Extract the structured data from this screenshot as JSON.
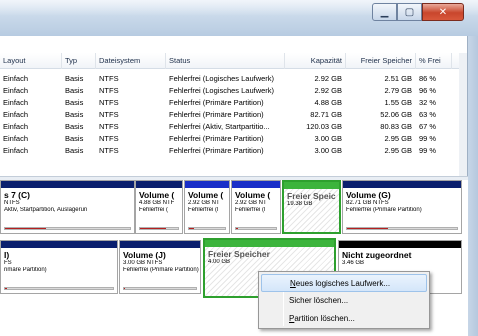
{
  "window": {
    "minimize_icon": "minimize-icon",
    "maximize_icon": "maximize-icon",
    "close_icon": "close-icon",
    "minimize_glyph": "▁",
    "maximize_glyph": "▢",
    "close_glyph": "✕"
  },
  "table": {
    "columns": [
      "Layout",
      "Typ",
      "Dateisystem",
      "Status",
      "Kapazität",
      "Freier Speicher",
      "% Frei"
    ],
    "rows": [
      [
        "Einfach",
        "Basis",
        "NTFS",
        "Fehlerfrei (Logisches Laufwerk)",
        "2.92 GB",
        "2.51 GB",
        "86 %"
      ],
      [
        "Einfach",
        "Basis",
        "NTFS",
        "Fehlerfrei (Logisches Laufwerk)",
        "2.92 GB",
        "2.79 GB",
        "96 %"
      ],
      [
        "Einfach",
        "Basis",
        "NTFS",
        "Fehlerfrei (Primäre Partition)",
        "4.88 GB",
        "1.55 GB",
        "32 %"
      ],
      [
        "Einfach",
        "Basis",
        "NTFS",
        "Fehlerfrei (Primäre Partition)",
        "82.71 GB",
        "52.06 GB",
        "63 %"
      ],
      [
        "Einfach",
        "Basis",
        "NTFS",
        "Fehlerfrei (Aktiv, Startpartitio...",
        "120.03 GB",
        "80.83 GB",
        "67 %"
      ],
      [
        "Einfach",
        "Basis",
        "NTFS",
        "Fehlerfrei (Primäre Partition)",
        "3.00 GB",
        "2.95 GB",
        "99 %"
      ],
      [
        "Einfach",
        "Basis",
        "NTFS",
        "Fehlerfrei (Primäre Partition)",
        "3.00 GB",
        "2.95 GB",
        "99 %"
      ]
    ]
  },
  "disk1": {
    "partitions": [
      {
        "title": "s 7 (C)",
        "line1": "NTFS",
        "line2": "Aktiv, Startpartition, Auslagerun",
        "used_fraction": 0.33,
        "bar": "#0a1f6e"
      },
      {
        "title": "Volume (",
        "line1": "4.88 GB NTF",
        "line2": "Fehlerfrei (",
        "used_fraction": 0.68,
        "bar": "#0a1f6e"
      },
      {
        "title": "Volume (",
        "line1": "2.92 GB NT",
        "line2": "Fehlerfrei (l",
        "used_fraction": 0.14,
        "bar": "#1a2fc8"
      },
      {
        "title": "Volume (",
        "line1": "2.92 GB NT",
        "line2": "Fehlerfrei (l",
        "used_fraction": 0.04,
        "bar": "#1a2fc8"
      },
      {
        "title": "Freier Speic",
        "line1": "19.38 GB",
        "line2": "",
        "used_fraction": 0,
        "bar": "#3cb43c"
      },
      {
        "title": "Volume (G)",
        "line1": "82.71 GB NTFS",
        "line2": "Fehlerfrei (Primäre Partition)",
        "used_fraction": 0.37,
        "bar": "#0a1f6e"
      }
    ]
  },
  "disk2": {
    "partitions": [
      {
        "title": "I)",
        "line1": "FS",
        "line2": "rimäre Partition)",
        "used_fraction": 0.02,
        "bar": "#0a1f6e"
      },
      {
        "title": "Volume (J)",
        "line1": "3.00 GB NTFS",
        "line2": "Fehlerfrei (Primäre Partition)",
        "used_fraction": 0.02,
        "bar": "#0a1f6e"
      },
      {
        "title": "Freier Speicher",
        "line1": "4.00 GB",
        "line2": "",
        "used_fraction": 0,
        "bar": "#3cb43c"
      },
      {
        "title": "Nicht zugeordnet",
        "line1": "3.46 GB",
        "line2": "",
        "used_fraction": 0,
        "bar": "#000000"
      }
    ]
  },
  "context_menu": {
    "items": [
      {
        "accel": "N",
        "rest": "eues logisches Laufwerk...",
        "highlighted": true
      },
      {
        "accel": "",
        "rest": "Sicher löschen...",
        "highlighted": false
      },
      {
        "accel": "P",
        "rest": "artition löschen...",
        "highlighted": false
      }
    ]
  }
}
